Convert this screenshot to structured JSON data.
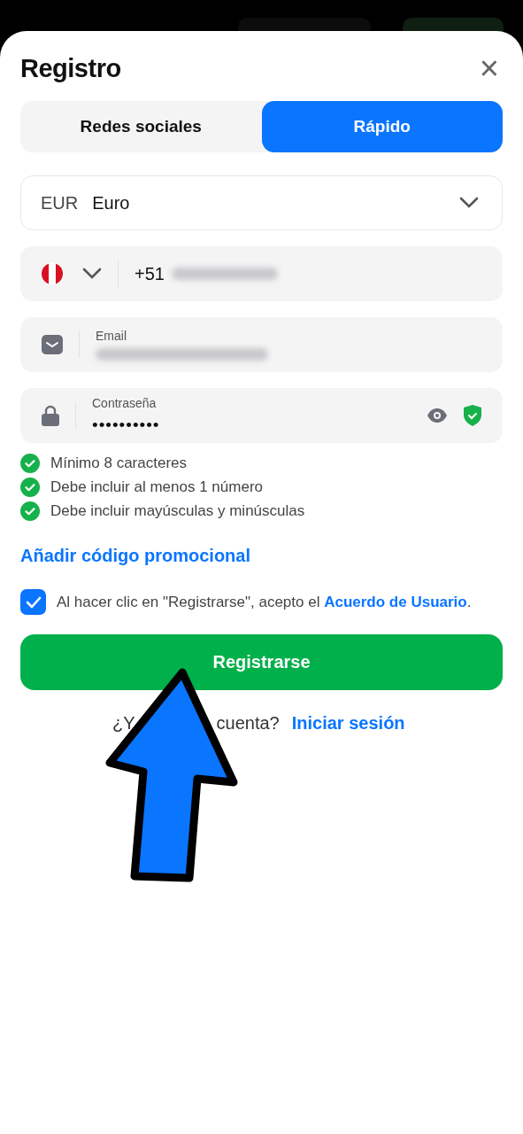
{
  "modal": {
    "title": "Registro",
    "close": "×"
  },
  "tabs": [
    {
      "label": "Redes sociales",
      "selected": false
    },
    {
      "label": "Rápido",
      "selected": true
    }
  ],
  "currency": {
    "code": "EUR",
    "name": "Euro"
  },
  "phone": {
    "prefix": "+51"
  },
  "email": {
    "label": "Email"
  },
  "password": {
    "label": "Contraseña",
    "value": "••••••••••"
  },
  "rules": [
    {
      "text": "Mínimo 8 caracteres",
      "met": true
    },
    {
      "text": "Debe incluir al menos 1 número",
      "met": true
    },
    {
      "text": "Debe incluir mayúsculas y minúsculas",
      "met": true
    }
  ],
  "promo_link": "Añadir código promocional",
  "agreement": {
    "checked": true,
    "text": "Al hacer clic en \"Registrarse\", acepto el",
    "link": "Acuerdo de Usuario",
    "end": "."
  },
  "submit": "Registrarse",
  "login": {
    "question_start": "¿Y",
    "question_end": "cuenta?",
    "link": "Iniciar sesión"
  }
}
